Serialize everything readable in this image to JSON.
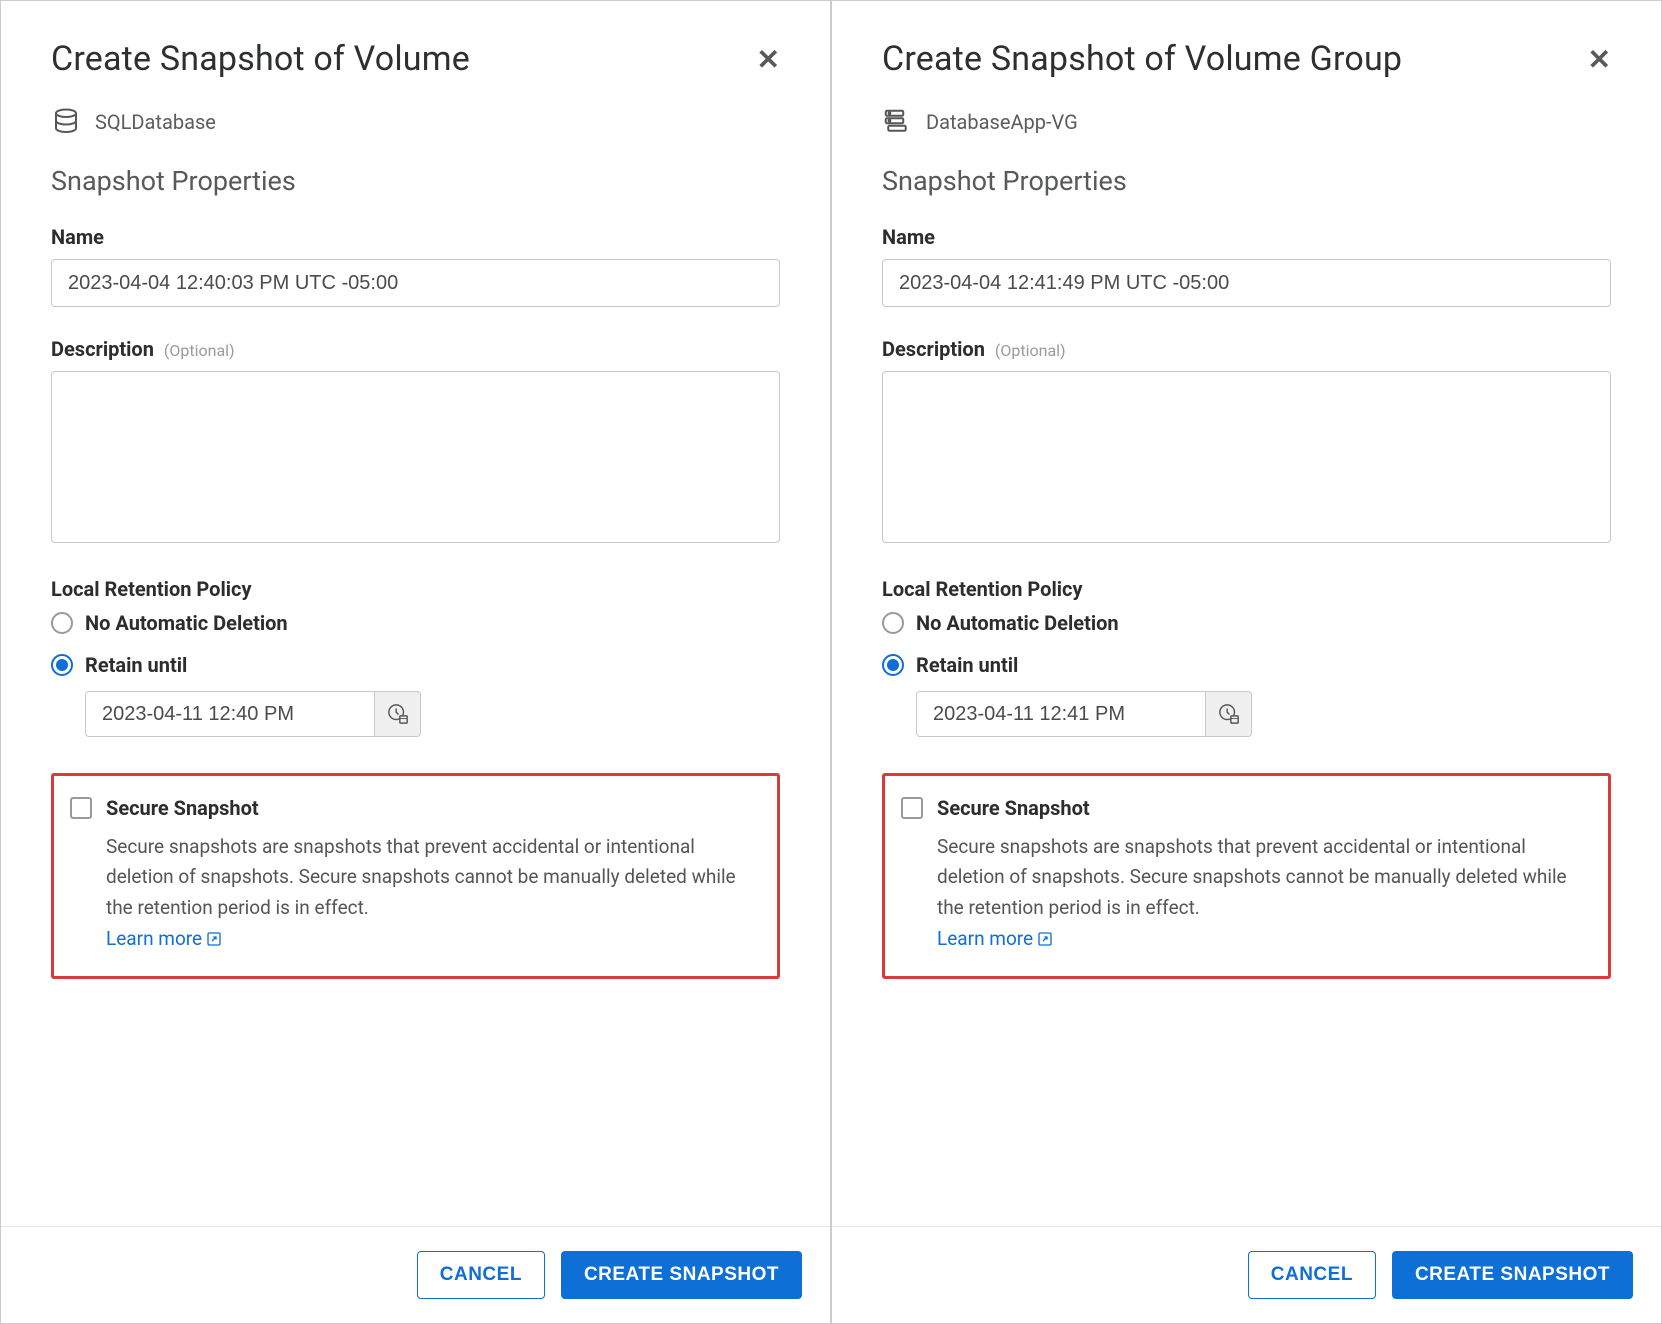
{
  "dialogs": [
    {
      "title": "Create Snapshot of Volume",
      "resource_name": "SQLDatabase",
      "resource_icon": "database-icon",
      "properties_heading": "Snapshot Properties",
      "fields": {
        "name_label": "Name",
        "name_value": "2023-04-04 12:40:03 PM UTC -05:00",
        "description_label": "Description",
        "description_optional": "(Optional)",
        "description_value": ""
      },
      "retention": {
        "heading": "Local Retention Policy",
        "option_none": "No Automatic Deletion",
        "option_retain": "Retain until",
        "selected": "retain",
        "retain_date": "2023-04-11 12:40 PM"
      },
      "secure": {
        "label": "Secure Snapshot",
        "checked": false,
        "help": "Secure snapshots are snapshots that prevent accidental or intentional deletion of snapshots. Secure snapshots cannot be manually deleted while the retention period is in effect.",
        "learn_more": "Learn more"
      },
      "buttons": {
        "cancel": "CANCEL",
        "create": "CREATE SNAPSHOT"
      }
    },
    {
      "title": "Create Snapshot of Volume Group",
      "resource_name": "DatabaseApp-VG",
      "resource_icon": "volume-group-icon",
      "properties_heading": "Snapshot Properties",
      "fields": {
        "name_label": "Name",
        "name_value": "2023-04-04 12:41:49 PM UTC -05:00",
        "description_label": "Description",
        "description_optional": "(Optional)",
        "description_value": ""
      },
      "retention": {
        "heading": "Local Retention Policy",
        "option_none": "No Automatic Deletion",
        "option_retain": "Retain until",
        "selected": "retain",
        "retain_date": "2023-04-11 12:41 PM"
      },
      "secure": {
        "label": "Secure Snapshot",
        "checked": false,
        "help": "Secure snapshots are snapshots that prevent accidental or intentional deletion of snapshots. Secure snapshots cannot be manually deleted while the retention period is in effect.",
        "learn_more": "Learn more"
      },
      "buttons": {
        "cancel": "CANCEL",
        "create": "CREATE SNAPSHOT"
      }
    }
  ]
}
